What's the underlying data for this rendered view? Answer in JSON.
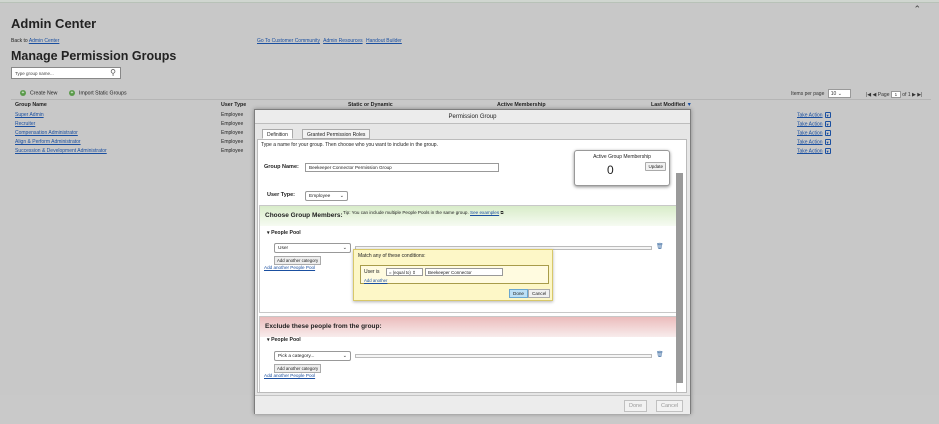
{
  "page": {
    "title": "Admin Center",
    "back_prefix": "Back to",
    "back_link": "Admin Center",
    "top_links": [
      "Go To Customer Community",
      "Admin Resources",
      "Handout Builder"
    ],
    "heading": "Manage Permission Groups",
    "search_placeholder": "Type group name..."
  },
  "toolbar": {
    "create_new": "Create New",
    "import_static": "Import Static Groups",
    "items_per_page_label": "Items per page",
    "items_per_page_value": "10",
    "page_label": "Page",
    "page_value": "1",
    "page_of": "of 1"
  },
  "table": {
    "headers": [
      "Group Name",
      "User Type",
      "Static or Dynamic",
      "Active Membership",
      "Last Modified"
    ],
    "rows": [
      {
        "name": "Super Admin",
        "type": "Employee"
      },
      {
        "name": "Recruiter",
        "type": "Employee"
      },
      {
        "name": "Compensation Administrator",
        "type": "Employee"
      },
      {
        "name": "Align & Perform Administrator",
        "type": "Employee"
      },
      {
        "name": "Succession & Development Administrator",
        "type": "Employee"
      }
    ],
    "action_label": "Take Action"
  },
  "modal": {
    "title": "Permission Group",
    "tabs": [
      "Definition",
      "Granted Permission Roles"
    ],
    "hint": "Type a name for your group. Then choose who you want to include in the group.",
    "group_name_label": "Group Name:",
    "group_name_value": "Beekeeper Connector Permission Group",
    "active_membership_title": "Active Group Membership",
    "active_membership_count": "0",
    "update_label": "Update",
    "user_type_label": "User Type:",
    "user_type_value": "Employee",
    "choose_title": "Choose Group Members:",
    "tip_text": "Tip: You can include multiple People Pools in the same group.",
    "tip_link": "See examples",
    "people_pool_label": "People Pool",
    "include_category": "User",
    "add_category": "Add another category",
    "add_pool": "Add another People Pool",
    "exclude_title": "Exclude these people from the group:",
    "exclude_category": "Pick a category...",
    "done_label": "Done",
    "cancel_label": "Cancel"
  },
  "popup": {
    "title": "Match any of these conditions:",
    "condition_label": "User is",
    "operator": "= (equal to)",
    "value": "Beekeeper Connector",
    "add_another": "Add another",
    "done": "Done",
    "cancel": "Cancel"
  }
}
